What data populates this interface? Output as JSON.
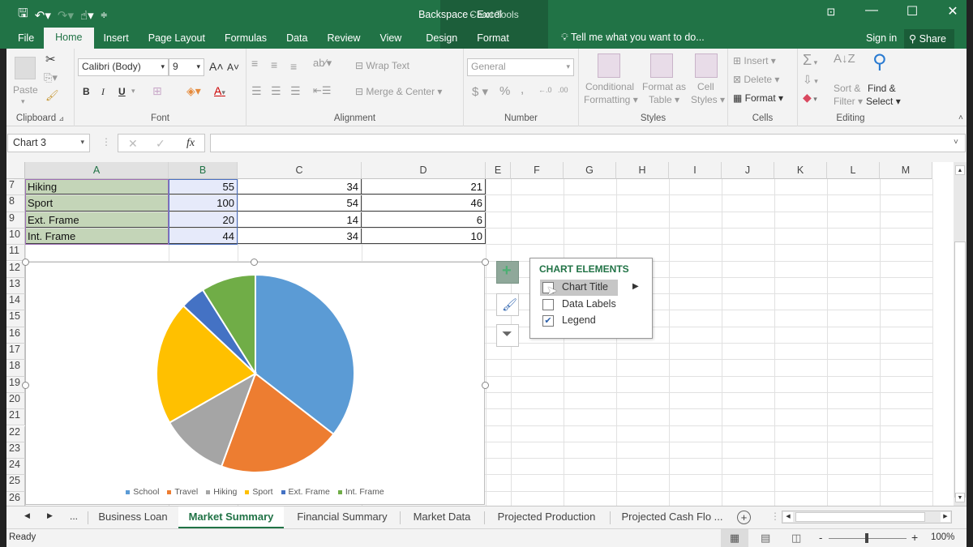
{
  "window": {
    "title": "Backspace - Excel",
    "context_tab_group": "Chart Tools",
    "tell_me_placeholder": "Tell me what you want to do...",
    "sign_in": "Sign in",
    "share": "Share",
    "accent_color": "#217346"
  },
  "quick_access": {
    "icons": [
      "save-icon",
      "undo-icon",
      "redo-icon",
      "touch-mode-icon",
      "customize-icon"
    ]
  },
  "ribbon_tabs": [
    {
      "label": "File"
    },
    {
      "label": "Home",
      "active": true
    },
    {
      "label": "Insert"
    },
    {
      "label": "Page Layout"
    },
    {
      "label": "Formulas"
    },
    {
      "label": "Data"
    },
    {
      "label": "Review"
    },
    {
      "label": "View"
    },
    {
      "label": "Design"
    },
    {
      "label": "Format"
    }
  ],
  "ribbon": {
    "clipboard": {
      "label": "Clipboard",
      "paste": "Paste"
    },
    "font": {
      "label": "Font",
      "font_name": "Calibri (Body)",
      "font_size": "9",
      "bold": "B",
      "italic": "I",
      "underline": "U"
    },
    "alignment": {
      "label": "Alignment",
      "wrap_text": "Wrap Text",
      "merge_center": "Merge & Center"
    },
    "number": {
      "label": "Number",
      "format": "General",
      "currency": "$",
      "percent": "%",
      "comma": ","
    },
    "styles": {
      "label": "Styles",
      "conditional_1": "Conditional",
      "conditional_2": "Formatting",
      "format_as_table_1": "Format as",
      "format_as_table_2": "Table",
      "cell_styles_1": "Cell",
      "cell_styles_2": "Styles"
    },
    "cells": {
      "label": "Cells",
      "insert": "Insert",
      "delete": "Delete",
      "format": "Format"
    },
    "editing": {
      "label": "Editing",
      "sort_1": "Sort &",
      "sort_2": "Filter",
      "find_1": "Find &",
      "find_2": "Select"
    }
  },
  "formula_bar": {
    "name_box": "Chart 3",
    "cancel": "✕",
    "enter": "✓",
    "fx": "fx",
    "formula": ""
  },
  "columns": [
    "A",
    "B",
    "C",
    "D",
    "E",
    "F",
    "G",
    "H",
    "I",
    "J",
    "K",
    "L",
    "M"
  ],
  "rows": [
    "7",
    "8",
    "9",
    "10",
    "11",
    "12",
    "13",
    "14",
    "15",
    "16",
    "17",
    "18",
    "19",
    "20",
    "21",
    "22",
    "23",
    "24",
    "25",
    "26"
  ],
  "table_rows": [
    {
      "a": "Hiking",
      "b": "55",
      "c": "34",
      "d": "21"
    },
    {
      "a": "Sport",
      "b": "100",
      "c": "54",
      "d": "46"
    },
    {
      "a": "Ext. Frame",
      "b": "20",
      "c": "14",
      "d": "6"
    },
    {
      "a": "Int. Frame",
      "b": "44",
      "c": "34",
      "d": "10"
    }
  ],
  "chart_data": {
    "type": "pie",
    "title": "",
    "categories": [
      "School",
      "Travel",
      "Hiking",
      "Sport",
      "Ext. Frame",
      "Int. Frame"
    ],
    "values": [
      175,
      99,
      55,
      100,
      20,
      44
    ],
    "colors": [
      "#5b9bd5",
      "#ed7d31",
      "#a5a5a5",
      "#ffc000",
      "#4472c4",
      "#70ad47"
    ],
    "legend": "bottom",
    "start_angle_deg": 0
  },
  "chart_elements_popup": {
    "title": "CHART ELEMENTS",
    "items": [
      {
        "label": "Chart Title",
        "checked": false,
        "hovered": true
      },
      {
        "label": "Data Labels",
        "checked": false
      },
      {
        "label": "Legend",
        "checked": true
      }
    ]
  },
  "chart_side_buttons": [
    "chart-elements-button",
    "chart-styles-button",
    "chart-filters-button"
  ],
  "sheet_tabs": [
    {
      "label": "Business Loan"
    },
    {
      "label": "Market Summary",
      "active": true
    },
    {
      "label": "Financial Summary"
    },
    {
      "label": "Market Data"
    },
    {
      "label": "Projected Production"
    },
    {
      "label": "Projected Cash Flo ..."
    }
  ],
  "sheet_nav": {
    "more": "..."
  },
  "status": {
    "text": "Ready",
    "zoom": "100%",
    "zoom_minus": "-",
    "zoom_plus": "+"
  }
}
